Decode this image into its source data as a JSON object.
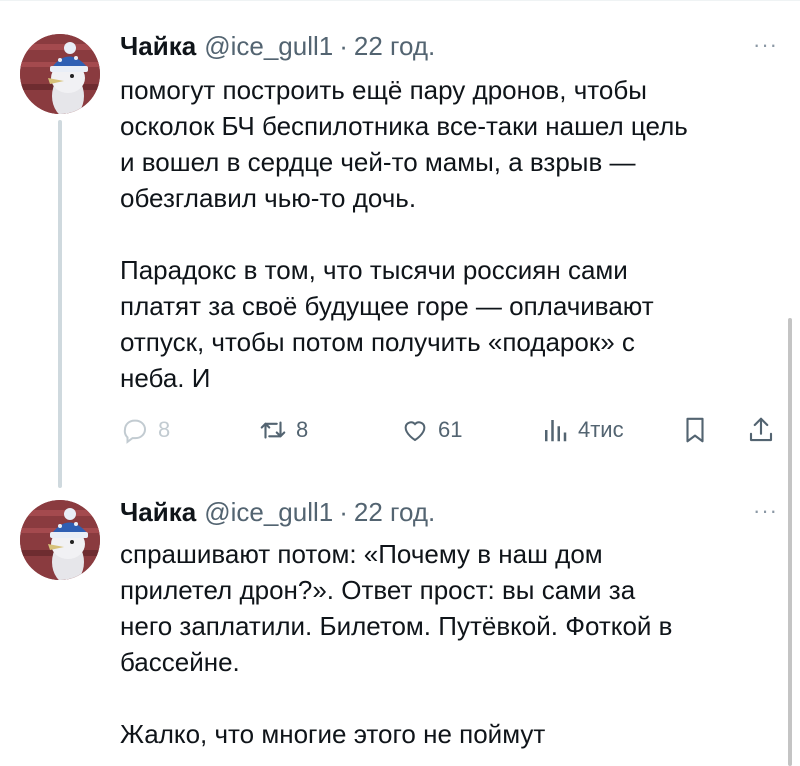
{
  "tweets": [
    {
      "author": "Чайка",
      "handle": "@ice_gull1",
      "separator": "·",
      "time": "22 год.",
      "more": "···",
      "paragraphs": [
        "помогут построить ещё пару дронов, чтобы\nосколок БЧ беспилотника все-таки нашел цель\nи вошел в сердце чей-то мамы, а взрыв —\nобезглавил чью-то дочь.",
        "Парадокс в том, что тысячи россиян сами\nплатят за своё будущее горе — оплачивают\nотпуск, чтобы потом получить «подарок» с\nнеба. И"
      ],
      "actions": {
        "reply_count": "8",
        "repost_count": "8",
        "like_count": "61",
        "views_count": "4тис"
      }
    },
    {
      "author": "Чайка",
      "handle": "@ice_gull1",
      "separator": "·",
      "time": "22 год.",
      "more": "···",
      "paragraphs": [
        "спрашивают потом: «Почему в наш дом\nприлетел дрон?». Ответ прост: вы сами за\nнего заплатили. Билетом. Путёвкой. Фоткой в\nбассейне.",
        "Жалко, что многие этого не поймут"
      ]
    }
  ],
  "icons": {
    "reply": "reply-icon",
    "repost": "repost-icon",
    "like": "heart-icon",
    "views": "analytics-icon",
    "bookmark": "bookmark-icon",
    "share": "share-icon",
    "more": "more-icon"
  },
  "colors": {
    "text": "#0f1419",
    "secondary": "#536471",
    "thread_line": "#cfd9de",
    "avatar_bg": "#8a3b3f",
    "avatar_hat": "#2f5fb3"
  }
}
